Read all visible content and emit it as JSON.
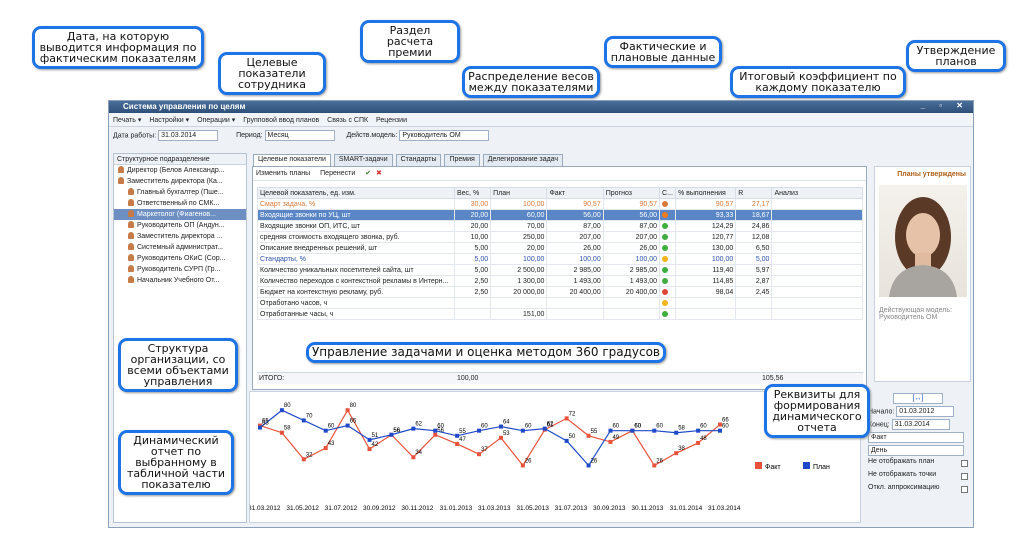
{
  "window": {
    "title": "Система управления по целям"
  },
  "menu": [
    "Печать ▾",
    "Настройки ▾",
    "Операции ▾",
    "Групповой ввод планов",
    "Связь с СПК",
    "Рецензии"
  ],
  "filter": {
    "date_label": "Дата работы:",
    "date": "31.03.2014",
    "period_label": "Период:",
    "period": "Месяц",
    "model_label": "Действ.модель:",
    "model": "Руководитель ОМ"
  },
  "left_panel": {
    "header": "Структурное подразделение",
    "items": [
      {
        "label": "Директор (Белов Александр...",
        "level": 0,
        "sel": false
      },
      {
        "label": "Заместитель директора (Ка...",
        "level": 0,
        "sel": false
      },
      {
        "label": "Главный бухгалтер (Пше...",
        "level": 1,
        "sel": false
      },
      {
        "label": "Ответственный по СМК...",
        "level": 1,
        "sel": false
      },
      {
        "label": "Маркетолог (Фиагенов...",
        "level": 1,
        "sel": true
      },
      {
        "label": "Руководитель ОП (Андун...",
        "level": 1,
        "sel": false
      },
      {
        "label": "Заместитель директора ...",
        "level": 1,
        "sel": false
      },
      {
        "label": "Системный администрат...",
        "level": 1,
        "sel": false
      },
      {
        "label": "Руководитель ОКиС (Сор...",
        "level": 1,
        "sel": false
      },
      {
        "label": "Руководитель СУРП (Гр...",
        "level": 1,
        "sel": false
      },
      {
        "label": "Начальник Учебного От...",
        "level": 1,
        "sel": false
      }
    ]
  },
  "tabs": [
    "Целевые показатели",
    "SMART-задачи",
    "Стандарты",
    "Премия",
    "Делегирование задач"
  ],
  "toolbar": {
    "edit": "Изменить планы",
    "move": "Перенести"
  },
  "table": {
    "headers": [
      "Целевой показатель, ед. изм.",
      "Вес, %",
      "План",
      "Факт",
      "Прогноз",
      "С...",
      "% выполнения",
      "R",
      "Анализ"
    ],
    "rows": [
      {
        "c": [
          "Смарт задача, %",
          "30,00",
          "100,00",
          "90,57",
          "90,57",
          "",
          "90,57",
          "27,17",
          ""
        ],
        "s": "#d9793a",
        "k": "sub"
      },
      {
        "c": [
          "Входящие звонки по УЦ, шт",
          "20,00",
          "60,00",
          "56,00",
          "56,00",
          "",
          "93,33",
          "18,67",
          ""
        ],
        "s": "#f07b1a",
        "k": "hl"
      },
      {
        "c": [
          "Входящие звонки ОП, ИТС, шт",
          "20,00",
          "70,00",
          "87,00",
          "87,00",
          "",
          "124,29",
          "24,86",
          ""
        ],
        "s": "#3fae3f",
        "k": ""
      },
      {
        "c": [
          "средняя стоимость входящего звонка, руб.",
          "10,00",
          "250,00",
          "207,00",
          "207,00",
          "",
          "120,77",
          "12,08",
          ""
        ],
        "s": "#3fae3f",
        "k": ""
      },
      {
        "c": [
          "Описание внедренных решений, шт",
          "5,00",
          "20,00",
          "26,00",
          "26,00",
          "",
          "130,00",
          "6,50",
          ""
        ],
        "s": "#3fae3f",
        "k": ""
      },
      {
        "c": [
          "Стандарты, %",
          "5,00",
          "100,00",
          "100,00",
          "100,00",
          "",
          "100,00",
          "5,00",
          ""
        ],
        "s": "#f2b31c",
        "k": "sub2"
      },
      {
        "c": [
          "Количество уникальных посетителей сайта, шт",
          "5,00",
          "2 500,00",
          "2 985,00",
          "2 985,00",
          "",
          "119,40",
          "5,97",
          ""
        ],
        "s": "#3fae3f",
        "k": ""
      },
      {
        "c": [
          "Количество переходов с контекстной рекламы в Интерн...",
          "2,50",
          "1 300,00",
          "1 493,00",
          "1 493,00",
          "",
          "114,85",
          "2,87",
          ""
        ],
        "s": "#3fae3f",
        "k": ""
      },
      {
        "c": [
          "Бюджет на контекстную рекламу, руб.",
          "2,50",
          "20 000,00",
          "20 400,00",
          "20 400,00",
          "",
          "98,04",
          "2,45",
          ""
        ],
        "s": "#e0453a",
        "k": ""
      },
      {
        "c": [
          "Отработано часов, ч",
          "",
          "",
          "",
          "",
          "",
          "",
          "",
          ""
        ],
        "s": "#f2b31c",
        "k": ""
      },
      {
        "c": [
          "Отработанные часы, ч",
          "",
          "151,00",
          "",
          "",
          "",
          "",
          "",
          ""
        ],
        "s": "#3fae3f",
        "k": ""
      }
    ],
    "total_label": "ИТОГО:",
    "total_weight": "100,00",
    "total_r": "105,56"
  },
  "right_panel": {
    "approved": "Планы утверждены",
    "model_caption": "Действующая модель: Руководитель ОМ"
  },
  "params": {
    "start_label": "Начало:",
    "start": "01.03.2012",
    "end_label": "Конец:",
    "end": "31.03.2014",
    "kind": "Факт",
    "step": "День",
    "opt1": "Не отображать план",
    "opt2": "Не отображать точки",
    "opt3": "Откл. аппроксимацию",
    "arrows": "[↔]"
  },
  "chart_data": {
    "type": "line",
    "x": [
      "31.03.2012",
      "31.05.2012",
      "31.07.2012",
      "30.09.2012",
      "30.11.2012",
      "31.01.2013",
      "31.03.2013",
      "31.05.2013",
      "31.07.2013",
      "30.09.2013",
      "30.11.2013",
      "31.01.2014",
      "31.03.2014"
    ],
    "series": [
      {
        "name": "Факт",
        "color": "#e8513a",
        "values": [
          65,
          58,
          32,
          43,
          80,
          42,
          56,
          34,
          56,
          47,
          37,
          53,
          26,
          61,
          72,
          55,
          49,
          60,
          26,
          38,
          48,
          66
        ]
      },
      {
        "name": "План",
        "color": "#1f49c9",
        "values": [
          63,
          80,
          70,
          60,
          65,
          51,
          56,
          62,
          60,
          55,
          60,
          64,
          60,
          62,
          50,
          26,
          60,
          60,
          60,
          58,
          60,
          60
        ]
      }
    ],
    "ylim": [
      0,
      90
    ]
  },
  "callouts": {
    "date": "Дата, на которую выводится информация по фактическим показателям",
    "targets": "Целевые показатели сотрудника",
    "bonus": "Раздел расчета премии",
    "weights": "Распределение весов между показателями",
    "plan_fact": "Фактические и плановые данные",
    "coef": "Итоговый коэффициент по каждому показателю",
    "approve": "Утверждение планов",
    "structure": "Структура организации, со всеми объектами управления",
    "tasks": "Управление задачами и оценка методом 360 градусов",
    "dynamic": "Динамический отчет по выбранному в табличной части показателю",
    "report": "Реквизиты для формирования динамического отчета"
  }
}
